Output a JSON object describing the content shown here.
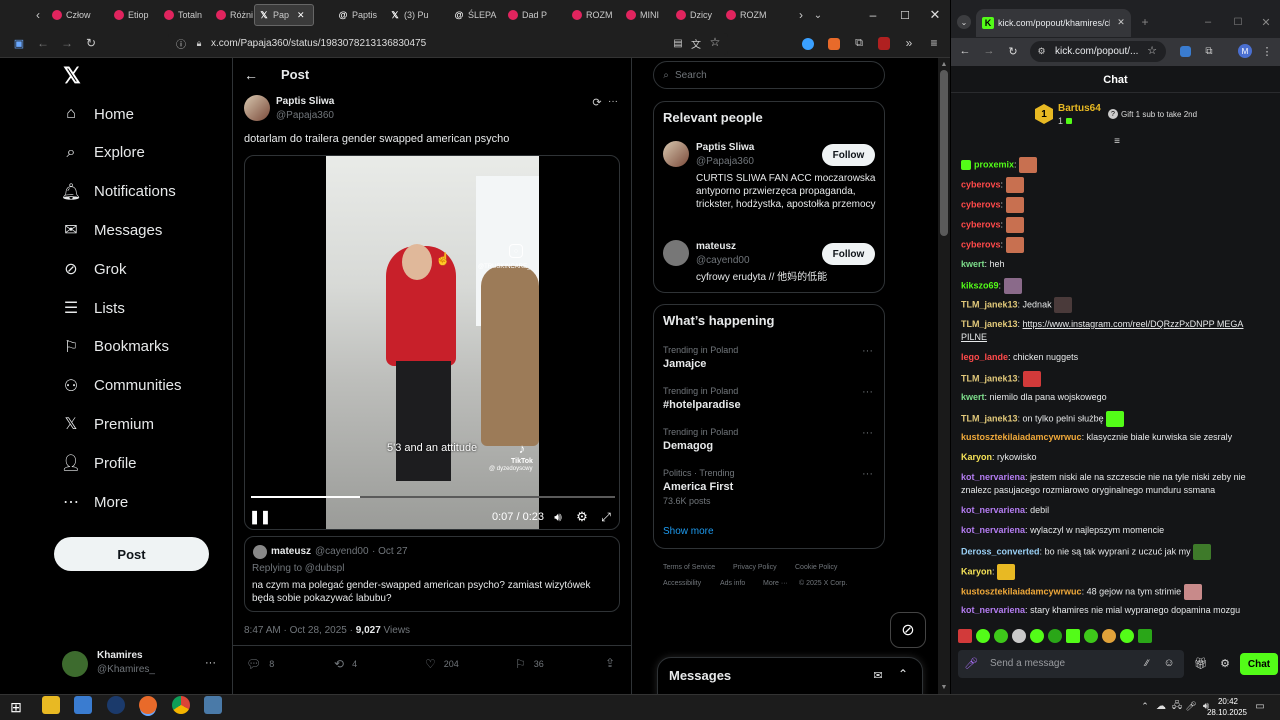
{
  "left_browser": {
    "tabs": [
      {
        "label": "Człow"
      },
      {
        "label": "Etiop"
      },
      {
        "label": "Totaln"
      },
      {
        "label": "Różni"
      },
      {
        "label": "Pap"
      },
      {
        "label": "Paptis"
      },
      {
        "label": "(3) Pu"
      },
      {
        "label": "ŚLEPA"
      },
      {
        "label": "Dad P"
      },
      {
        "label": "ROZM"
      },
      {
        "label": "MINI"
      },
      {
        "label": "Dzicy"
      },
      {
        "label": "ROZM"
      }
    ],
    "url": "x.com/Papaja360/status/1983078213136830475"
  },
  "x_nav": {
    "items": [
      {
        "label": "Home",
        "icon": "home-icon"
      },
      {
        "label": "Explore",
        "icon": "search-icon"
      },
      {
        "label": "Notifications",
        "icon": "bell-icon"
      },
      {
        "label": "Messages",
        "icon": "mail-icon"
      },
      {
        "label": "Grok",
        "icon": "grok-icon"
      },
      {
        "label": "Lists",
        "icon": "list-icon"
      },
      {
        "label": "Bookmarks",
        "icon": "bookmark-icon"
      },
      {
        "label": "Communities",
        "icon": "people-icon"
      },
      {
        "label": "Premium",
        "icon": "x-icon"
      },
      {
        "label": "Profile",
        "icon": "person-icon"
      },
      {
        "label": "More",
        "icon": "more-circle-icon"
      }
    ],
    "post_button": "Post",
    "account": {
      "name": "Khamires",
      "handle": "@Khamires_"
    }
  },
  "post": {
    "header": "Post",
    "author_name": "Paptis Sliwa",
    "author_handle": "@Papaja360",
    "text": "dotarlam do trailera gender swapped american psycho",
    "video": {
      "caption": "5'3 and an attitude",
      "watermark_top": "@TRUSKINCARE_",
      "tiktok": "TikTok",
      "tiktok_user": "@ dyzedoyscwy",
      "time": "0:07 / 0:23",
      "progress": 0.3
    },
    "quote": {
      "name": "mateusz",
      "handle": "@cayend00",
      "date": "· Oct 27",
      "replying": "Replying to @dubspl",
      "text": "na czym ma polegać gender-swapped american psycho? zamiast wizytówek będą sobie pokazywać labubu?"
    },
    "meta_time": "8:47 AM · Oct 28, 2025 · ",
    "meta_views": "9,027",
    "meta_views_label": " Views",
    "actions": {
      "replies": "8",
      "reposts": "4",
      "likes": "204",
      "bookmarks": "36"
    }
  },
  "right_col": {
    "search_placeholder": "Search",
    "relevant_title": "Relevant people",
    "people": [
      {
        "name": "Paptis Sliwa",
        "handle": "@Papaja360",
        "bio": "CURTIS SLIWA FAN ACC moczarowska antyporno przwierzęca propaganda, trickster, hodżystka, apostołka przemocy",
        "follow": "Follow"
      },
      {
        "name": "mateusz",
        "handle": "@cayend00",
        "bio": "cyfrowy erudyta // 他妈的低能",
        "follow": "Follow"
      }
    ],
    "happening_title": "What’s happening",
    "trends": [
      {
        "context": "Trending in Poland",
        "name": "Jamajce",
        "posts": ""
      },
      {
        "context": "Trending in Poland",
        "name": "#hotelparadise",
        "posts": ""
      },
      {
        "context": "Trending in Poland",
        "name": "Demagog",
        "posts": ""
      },
      {
        "context": "Politics · Trending",
        "name": "America First",
        "posts": "73.6K posts"
      }
    ],
    "show_more": "Show more",
    "footer": [
      "Terms of Service",
      "Privacy Policy",
      "Cookie Policy",
      "Accessibility",
      "Ads info",
      "More ···",
      "© 2025 X Corp."
    ],
    "messages_title": "Messages"
  },
  "right_browser": {
    "tab_title": "kick.com/popout/khamires/cha",
    "url": "kick.com/popout/...",
    "avatar_letter": "M"
  },
  "kick_chat": {
    "title": "Chat",
    "gift_user": "Bartus64",
    "gift_count": "1",
    "gift_rank": "1",
    "gift_text": "Gift 1 sub to take 2nd",
    "messages": [
      {
        "user": "proxemix",
        "color": "#53fc18",
        "text": ""
      },
      {
        "user": "cyberovs",
        "color": "#ff4a4a",
        "text": ""
      },
      {
        "user": "cyberovs",
        "color": "#ff4a4a",
        "text": ""
      },
      {
        "user": "cyberovs",
        "color": "#ff4a4a",
        "text": ""
      },
      {
        "user": "cyberovs",
        "color": "#ff4a4a",
        "text": ""
      },
      {
        "user": "kwert",
        "color": "#7cdc8a",
        "text": "heh"
      },
      {
        "user": "kikszo69",
        "color": "#53fc18",
        "text": ""
      },
      {
        "user": "TLM_janek13",
        "color": "#e2c97a",
        "text": "Jednak"
      },
      {
        "user": "TLM_janek13",
        "color": "#e2c97a",
        "text": "https://www.instagram.com/reel/DQRzzPxDNPP MEGA PILNE"
      },
      {
        "user": "lego_lande",
        "color": "#ff4a4a",
        "text": "chicken nuggets"
      },
      {
        "user": "TLM_janek13",
        "color": "#e2c97a",
        "text": ""
      },
      {
        "user": "kwert",
        "color": "#7cdc8a",
        "text": "niemilo dla pana wojskowego"
      },
      {
        "user": "TLM_janek13",
        "color": "#e2c97a",
        "text": "on tylko pelni służbę"
      },
      {
        "user": "kustosztekilaiadamcywrwuc",
        "color": "#f0a93a",
        "text": "klasycznie biale kurwiska sie zesraly"
      },
      {
        "user": "Karyon",
        "color": "#f5e257",
        "text": "rykowisko"
      },
      {
        "user": "kot_nervariena",
        "color": "#b37cf0",
        "text": "jestem niski ale na szczescie nie na tyle niski zeby nie znalezc pasujacego rozmiarowo oryginalnego munduru ssmana"
      },
      {
        "user": "kot_nervariena",
        "color": "#b37cf0",
        "text": "debil"
      },
      {
        "user": "kot_nervariena",
        "color": "#b37cf0",
        "text": "wylaczyl w najlepszym momencie"
      },
      {
        "user": "Deross_converted",
        "color": "#9ad0f5",
        "text": "bo nie są tak wyprani z uczuć jak my"
      },
      {
        "user": "Karyon",
        "color": "#f5e257",
        "text": ""
      },
      {
        "user": "kustosztekilaiadamcywrwuc",
        "color": "#f0a93a",
        "text": "48 gejow na tym strimie"
      },
      {
        "user": "kot_nervariena",
        "color": "#b37cf0",
        "text": "stary khamires nie mial wypranego dopamina mozgu"
      }
    ],
    "input_placeholder": "Send a message",
    "send_button": "Chat"
  },
  "taskbar": {
    "time": "20:42",
    "date": "28.10.2025"
  }
}
